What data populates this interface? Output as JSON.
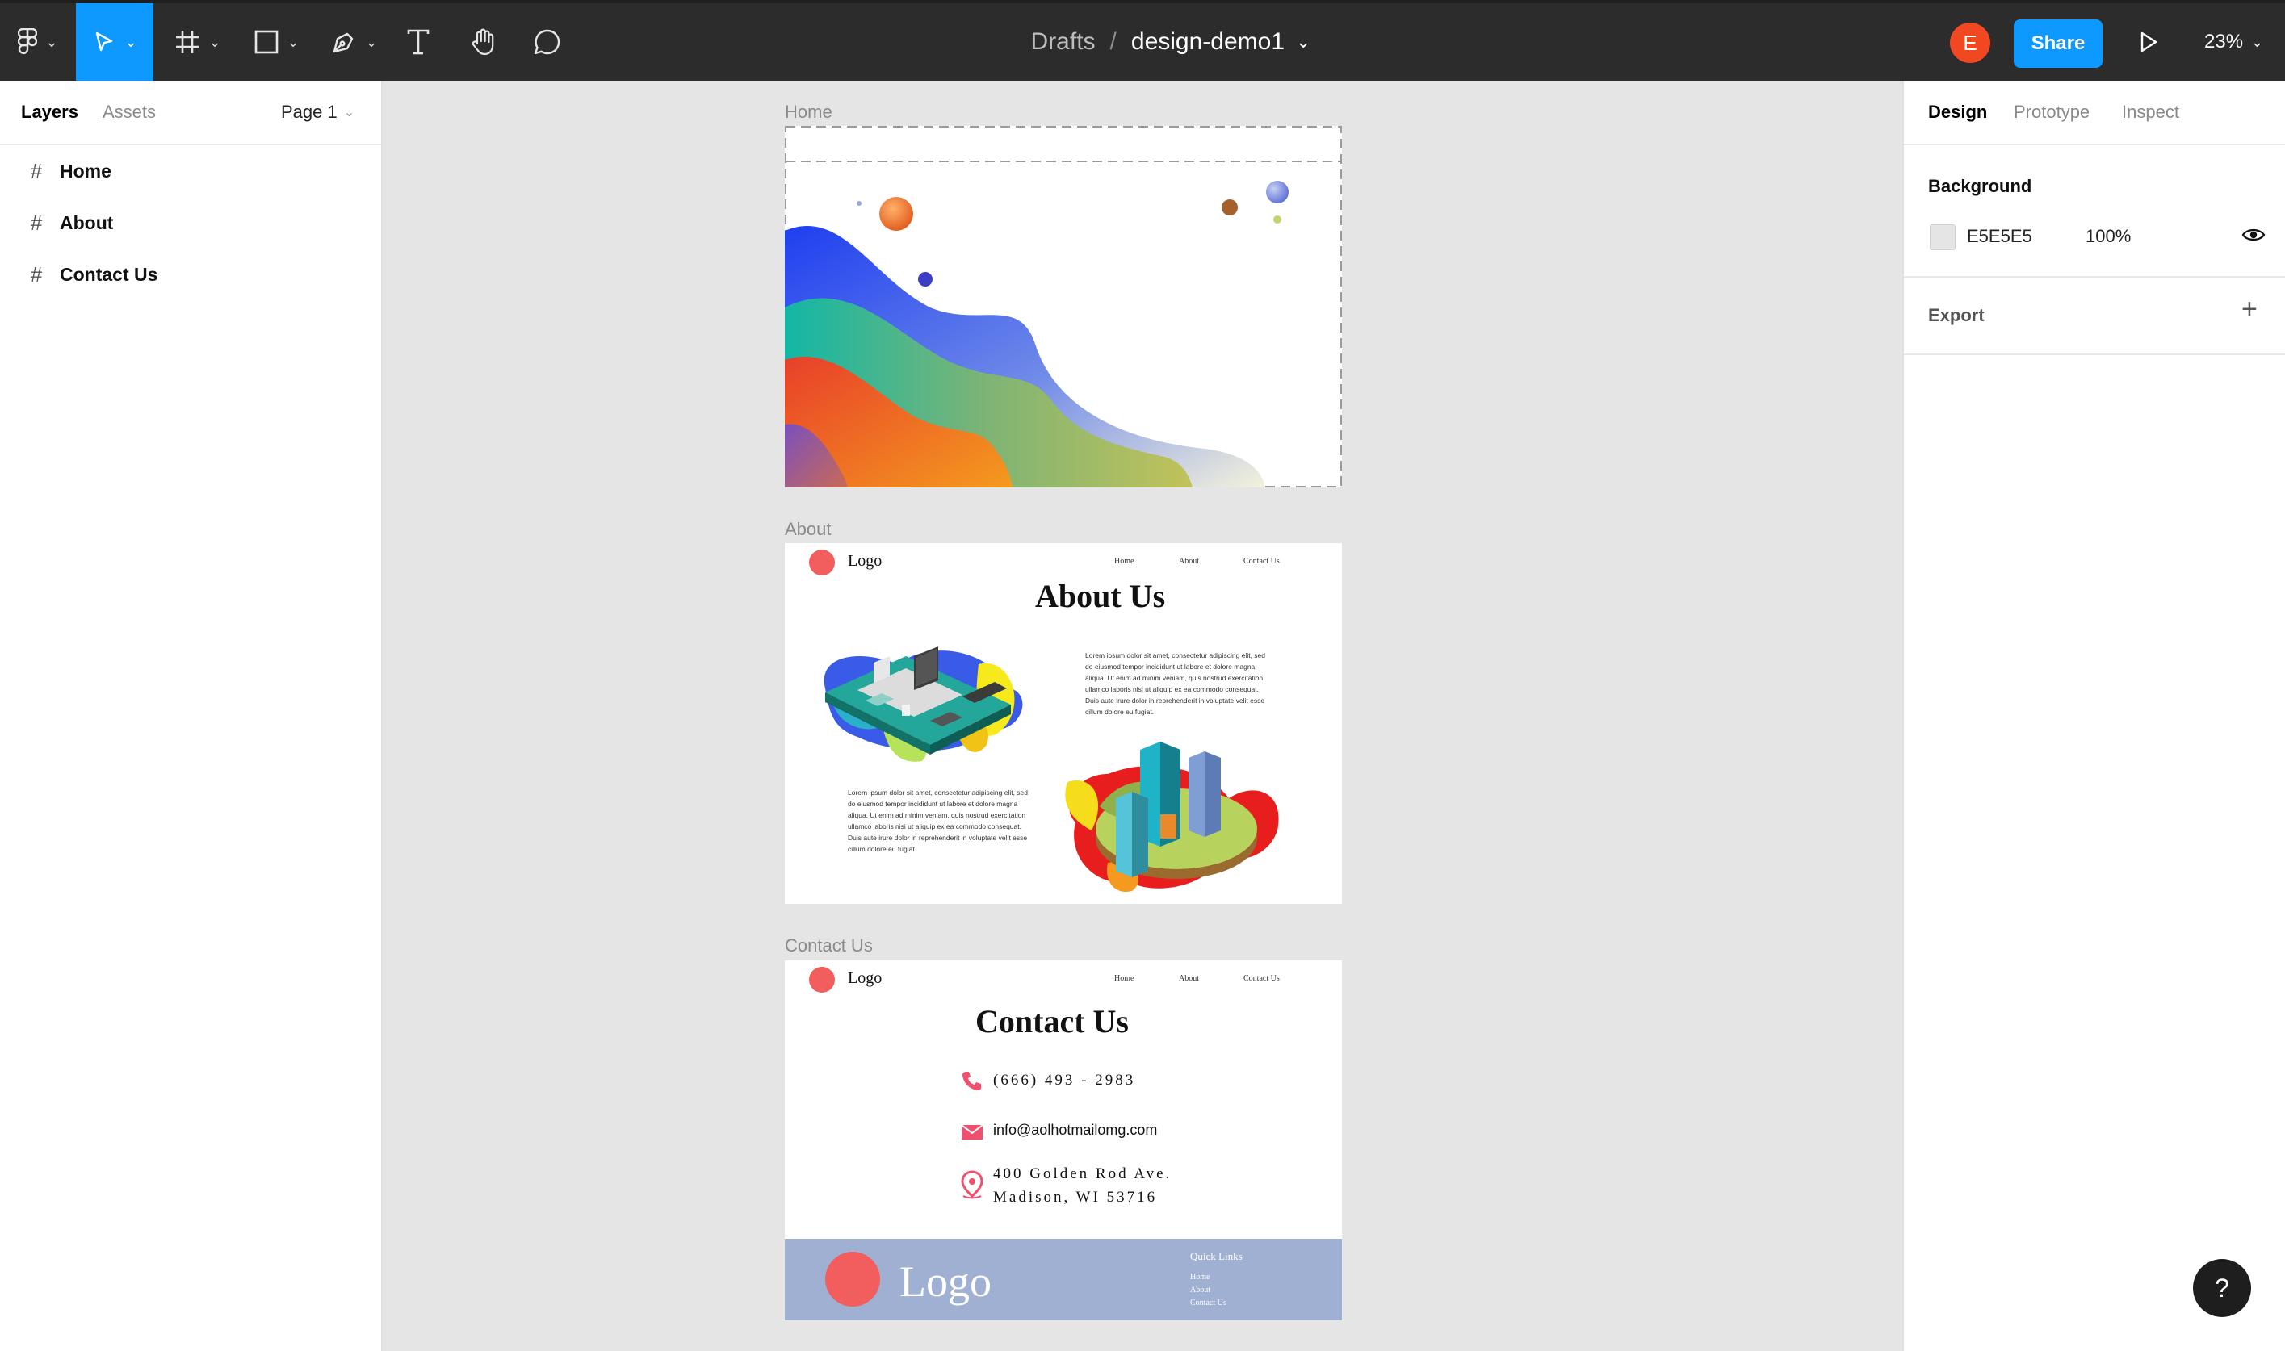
{
  "toolbar": {
    "main_menu_icon": "figma-logo-icon",
    "tools": [
      "move-tool-icon",
      "frame-tool-icon",
      "shape-tool-icon",
      "pen-tool-icon",
      "text-tool-icon",
      "hand-tool-icon",
      "comment-tool-icon"
    ],
    "breadcrumb_parent": "Drafts",
    "breadcrumb_separator": "/",
    "file_name": "design-demo1",
    "avatar_initial": "E",
    "share_label": "Share",
    "zoom_level": "23%"
  },
  "left_panel": {
    "tabs": [
      "Layers",
      "Assets"
    ],
    "page_selector": "Page 1",
    "layers": [
      {
        "label": "Home"
      },
      {
        "label": "About"
      },
      {
        "label": "Contact Us"
      }
    ]
  },
  "right_panel": {
    "tabs": [
      "Design",
      "Prototype",
      "Inspect"
    ],
    "background_title": "Background",
    "background_hex": "E5E5E5",
    "background_opacity": "100%",
    "export_title": "Export"
  },
  "canvas": {
    "home_frame": {
      "label": "Home"
    },
    "about_frame": {
      "label": "About",
      "logo_text": "Logo",
      "nav": [
        "Home",
        "About",
        "Contact Us"
      ],
      "heading": "About Us",
      "paragraph_1": "Lorem ipsum dolor sit amet, consectetur adipiscing elit, sed do eiusmod tempor incididunt ut labore et dolore magna aliqua. Ut enim ad minim veniam, quis nostrud exercitation ullamco laboris nisi ut aliquip ex ea commodo consequat. Duis aute irure dolor in reprehenderit in voluptate velit esse cillum dolore eu fugiat.",
      "paragraph_2": "Lorem ipsum dolor sit amet, consectetur adipiscing elit, sed do eiusmod tempor incididunt ut labore et dolore magna aliqua. Ut enim ad minim veniam, quis nostrud exercitation ullamco laboris nisi ut aliquip ex ea commodo consequat. Duis aute irure dolor in reprehenderit in voluptate velit esse cillum dolore eu fugiat."
    },
    "contact_frame": {
      "label": "Contact Us",
      "logo_text": "Logo",
      "nav": [
        "Home",
        "About",
        "Contact Us"
      ],
      "heading": "Contact Us",
      "phone": "(666) 493 - 2983",
      "email": "info@aolhotmailomg.com",
      "address_line_1": "400 Golden Rod Ave.",
      "address_line_2": "Madison, WI 53716",
      "footer_logo": "Logo",
      "quick_links_title": "Quick Links",
      "quick_links": [
        "Home",
        "About",
        "Contact Us"
      ]
    }
  },
  "help_label": "?",
  "colors": {
    "accent": "#0d99ff",
    "toolbar_bg": "#2c2c2c",
    "canvas_bg": "#e5e5e5",
    "logo_dot": "#f25d5d",
    "footer_bg": "#9fb0d2"
  }
}
